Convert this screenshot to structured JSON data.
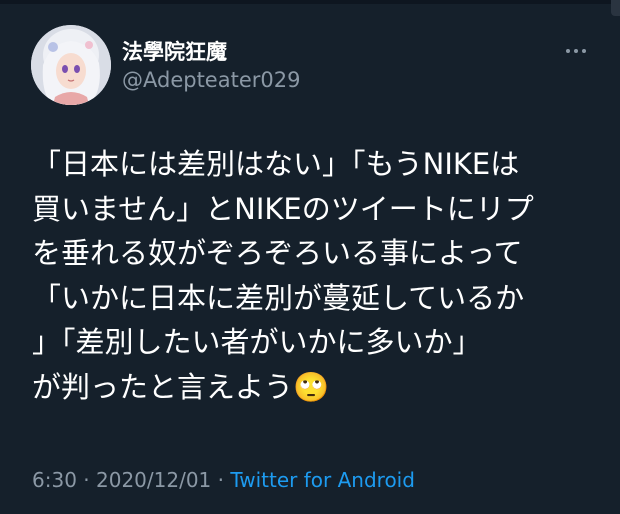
{
  "tweet": {
    "author": {
      "display_name": "法學院狂魔",
      "handle": "@Adepteater029"
    },
    "more_icon": "ellipsis-icon",
    "text_lines": [
      "「日本には差別はない」「もうNIKEは",
      "買いません」とNIKEのツイートにリプ",
      "を垂れる奴がぞろぞろいる事によって",
      "「いかに日本に差別が蔓延しているか",
      "」「差別したい者がいかに多いか」",
      "が判ったと言えよう🙄"
    ],
    "time": "6:30",
    "separator": " · ",
    "date": "2020/12/01",
    "separator2": " · ",
    "source": "Twitter for Android"
  },
  "colors": {
    "background": "#15202b",
    "secondary_text": "#8b98a5",
    "link": "#1d9bf0"
  }
}
